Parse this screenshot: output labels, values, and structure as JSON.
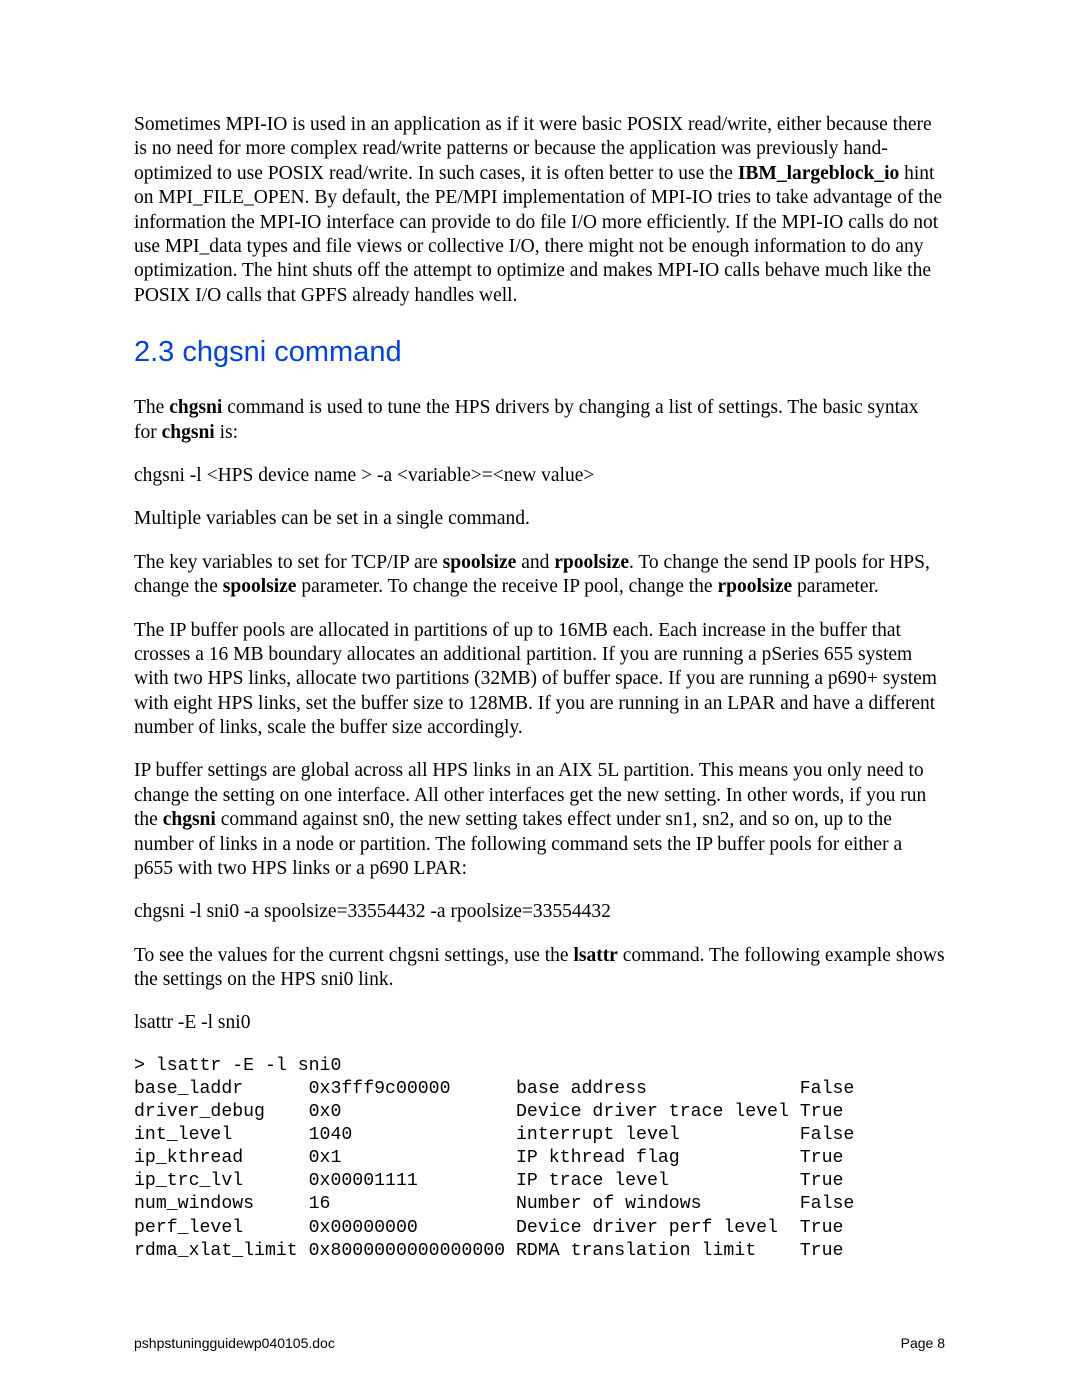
{
  "intro": {
    "p1_a": "Sometimes MPI-IO is used in an application as if it were basic POSIX read/write, either because there is no need for more complex read/write patterns or because the application was previously hand-optimized to use POSIX read/write.  In such cases, it is often better to use the ",
    "p1_bold": "IBM_largeblock_io",
    "p1_b": " hint on MPI_FILE_OPEN.  By default, the PE/MPI implementation of MPI-IO tries to take advantage of the information the MPI-IO interface can provide to do file I/O more efficiently.  If the MPI-IO calls do not use MPI_data types and file views or collective I/O, there might not be enough information to do any optimization.  The hint shuts off the attempt to optimize and makes MPI-IO calls behave much like the POSIX I/O calls that GPFS already handles well."
  },
  "heading": "2.3 chgsni command",
  "p2": {
    "a": "The ",
    "b1": "chgsni",
    "b": " command is used to tune the HPS drivers by changing a list of settings.  The basic syntax for ",
    "b2": "chgsni",
    "c": " is:"
  },
  "cmd1": "chgsni -l <HPS device name > -a <variable>=<new value>",
  "p3": "Multiple variables can be set in a single command.",
  "p4": {
    "a": "The key variables to set for TCP/IP are ",
    "b1": "spoolsize",
    "b": " and ",
    "b2": "rpoolsize",
    "c": ".  To change the send IP pools for HPS, change the ",
    "b3": "spoolsize",
    "d": " parameter.  To change the receive IP pool, change the ",
    "b4": "rpoolsize",
    "e": " parameter."
  },
  "p5": "The IP buffer pools are allocated in partitions of up to 16MB each. Each increase in the buffer that crosses a 16 MB boundary allocates an additional partition.  If you are running a pSeries 655 system with two HPS links, allocate two partitions (32MB) of buffer space.  If you are running a p690+ system with eight HPS links, set the buffer size to 128MB.  If you are running in an LPAR and have a different number of links, scale the buffer size accordingly.",
  "p6": {
    "a": "IP buffer settings are global across all HPS links in an AIX 5L partition.  This means you only need to change the setting on one interface.  All other interfaces get the new setting. In other words, if you run the ",
    "b1": "chgsni",
    "b": " command against sn0, the new setting takes effect under sn1, sn2, and so on, up to the number of links in a node or partition.  The following command sets the IP buffer pools for either a p655 with two HPS links or a p690 LPAR:"
  },
  "cmd2": "chgsni -l sni0 -a  spoolsize=33554432 -a rpoolsize=33554432",
  "p7": {
    "a": "To see the values for the current chgsni settings, use the ",
    "b1": "lsattr",
    "b": " command.  The following example shows the settings on the HPS sni0 link."
  },
  "cmd3": "lsattr -E -l sni0",
  "output": {
    "prompt": "> lsattr -E -l sni0",
    "rows": [
      {
        "attr": "base_laddr",
        "val": "0x3fff9c00000",
        "desc": "base address",
        "flag": "False"
      },
      {
        "attr": "driver_debug",
        "val": "0x0",
        "desc": "Device driver trace level",
        "flag": "True"
      },
      {
        "attr": "int_level",
        "val": "1040",
        "desc": "interrupt level",
        "flag": "False"
      },
      {
        "attr": "ip_kthread",
        "val": "0x1",
        "desc": "IP kthread flag",
        "flag": "True"
      },
      {
        "attr": "ip_trc_lvl",
        "val": "0x00001111",
        "desc": "IP trace level",
        "flag": "True"
      },
      {
        "attr": "num_windows",
        "val": "16",
        "desc": "Number of windows",
        "flag": "False"
      },
      {
        "attr": "perf_level",
        "val": "0x00000000",
        "desc": "Device driver perf level",
        "flag": "True"
      },
      {
        "attr": "rdma_xlat_limit",
        "val": "0x8000000000000000",
        "desc": "RDMA translation limit",
        "flag": "True"
      }
    ]
  },
  "footer": {
    "file": "pshpstuningguidewp040105.doc",
    "page": "Page 8"
  }
}
